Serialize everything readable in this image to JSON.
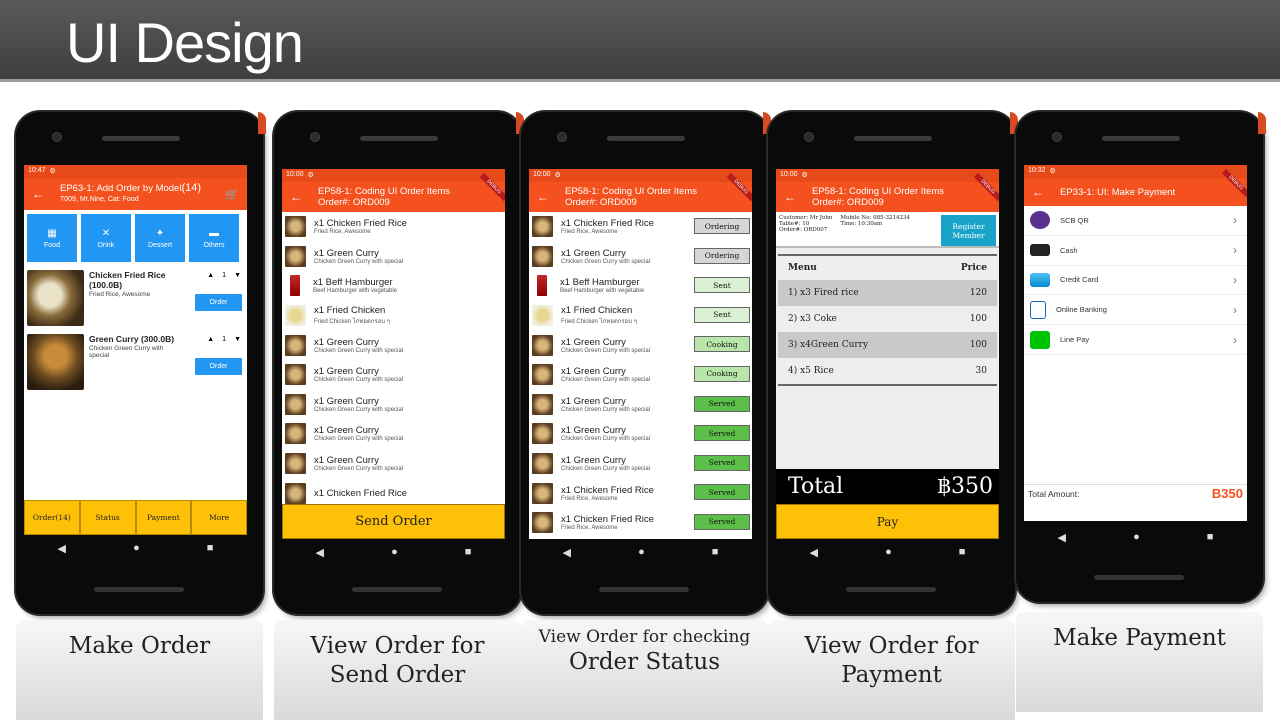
{
  "slide_title": "UI Design",
  "phone1": {
    "status_time": "10:47",
    "title": "EP63-1: Add Order by Model",
    "title_count": "(14)",
    "subtitle": "T009, Mr.Nine, Cat: Food",
    "categories": [
      "Food",
      "Drink",
      "Dessert",
      "Others"
    ],
    "items": [
      {
        "name": "Chicken Fried Rice (100.0B)",
        "desc": "Fried Rice, Awesome",
        "qty": "1",
        "button": "Order"
      },
      {
        "name": "Green Curry (300.0B)",
        "desc": "Chicken Green Curry with special",
        "qty": "1",
        "button": "Order"
      }
    ],
    "tabs": [
      "Order(14)",
      "Status",
      "Payment",
      "More"
    ]
  },
  "phone2": {
    "status_time": "10:00",
    "title": "EP58-1: Coding UI Order Items",
    "order_no": "Order#: ORD009",
    "items": [
      {
        "name": "x1 Chicken Fried Rice",
        "desc": "Fried Rice, Awesome"
      },
      {
        "name": "x1 Green Curry",
        "desc": "Chicken Green Curry with special"
      },
      {
        "name": "x1 Beff Hamburger",
        "desc": "Beef Hamburger with vegetable"
      },
      {
        "name": "x1 Fried Chicken",
        "desc": "Fried Chicken ไก่ทอดกรอบ ๆ"
      },
      {
        "name": "x1 Green Curry",
        "desc": "Chicken Green Curry with special"
      },
      {
        "name": "x1 Green Curry",
        "desc": "Chicken Green Curry with special"
      },
      {
        "name": "x1 Green Curry",
        "desc": "Chicken Green Curry with special"
      },
      {
        "name": "x1 Green Curry",
        "desc": "Chicken Green Curry with special"
      },
      {
        "name": "x1 Green Curry",
        "desc": "Chicken Green Curry with special"
      },
      {
        "name": "x1 Chicken Fried Rice",
        "desc": ""
      }
    ],
    "button": "Send Order"
  },
  "phone3": {
    "status_time": "10:00",
    "title": "EP58-1: Coding UI Order Items",
    "order_no": "Order#: ORD009",
    "items": [
      {
        "name": "x1 Chicken Fried Rice",
        "desc": "Fried Rice, Awesome",
        "status": "Ordering"
      },
      {
        "name": "x1 Green Curry",
        "desc": "Chicken Green Curry with special",
        "status": "Ordering"
      },
      {
        "name": "x1 Beff Hamburger",
        "desc": "Beef Hamburger with vegetable",
        "status": "Sent"
      },
      {
        "name": "x1 Fried Chicken",
        "desc": "Fried Chicken ไก่ทอดกรอบ ๆ",
        "status": "Sent"
      },
      {
        "name": "x1 Green Curry",
        "desc": "Chicken Green Curry with special",
        "status": "Cooking"
      },
      {
        "name": "x1 Green Curry",
        "desc": "Chicken Green Curry with special",
        "status": "Cooking"
      },
      {
        "name": "x1 Green Curry",
        "desc": "Chicken Green Curry with special",
        "status": "Served"
      },
      {
        "name": "x1 Green Curry",
        "desc": "Chicken Green Curry with special",
        "status": "Served"
      },
      {
        "name": "x1 Green Curry",
        "desc": "Chicken Green Curry with special",
        "status": "Served"
      },
      {
        "name": "x1 Chicken Fried Rice",
        "desc": "Fried Rice, Awesome",
        "status": "Served"
      },
      {
        "name": "x1 Chicken Fried Rice",
        "desc": "Fried Rice, Awesome",
        "status": "Served"
      }
    ]
  },
  "phone4": {
    "status_time": "10:00",
    "title": "EP58-1: Coding UI Order Items",
    "order_no": "Order#: ORD009",
    "customer": "Customer: Mr John",
    "table": "Table#: 10",
    "order": "Order#: ORD007",
    "mobile": "Mobile No: 085-3214234",
    "time": "Time: 10:30am",
    "register": "Register Member",
    "menu_header": "Menu",
    "price_header": "Price",
    "rows": [
      {
        "item": "1) x3 Fired rice",
        "price": "120"
      },
      {
        "item": "2) x3 Coke",
        "price": "100"
      },
      {
        "item": "3) x4Green Curry",
        "price": "100"
      },
      {
        "item": "4) x5 Rice",
        "price": "30"
      }
    ],
    "total_label": "Total",
    "total_value": "฿350",
    "button": "Pay"
  },
  "phone5": {
    "status_time": "10:32",
    "title": "EP33-1: UI: Make Payment",
    "methods": [
      "SCB QR",
      "Cash",
      "Credit Card",
      "Online Banking",
      "Line Pay"
    ],
    "total_label": "Total Amount:",
    "total_value": "B350"
  },
  "captions": {
    "c1": "Make Order",
    "c2a": "View Order for",
    "c2b": "Send Order",
    "c3a": "View Order for checking",
    "c3b": "Order Status",
    "c4a": "View Order for",
    "c4b": "Payment",
    "c5": "Make Payment"
  },
  "colors": {
    "appbar": "#f4511e",
    "accent_button": "#ffc107",
    "category": "#2196f3"
  }
}
